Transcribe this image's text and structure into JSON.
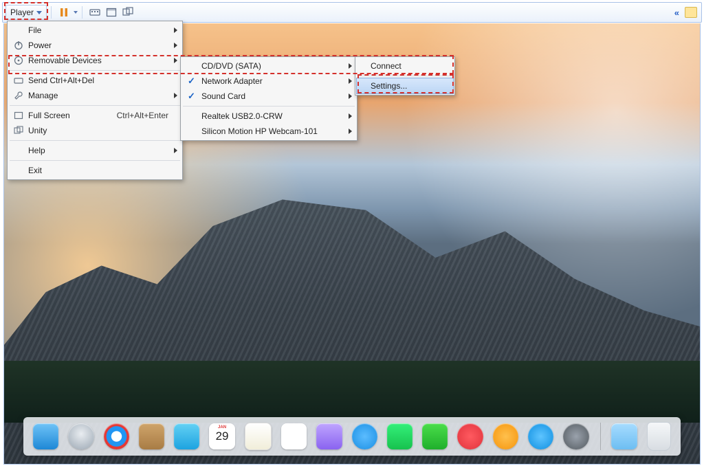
{
  "toolbar": {
    "player_label": "Player"
  },
  "menu_main": {
    "file": "File",
    "power": "Power",
    "removable": "Removable Devices",
    "send_cad": "Send Ctrl+Alt+Del",
    "manage": "Manage",
    "fullscreen": "Full Screen",
    "fullscreen_shortcut": "Ctrl+Alt+Enter",
    "unity": "Unity",
    "help": "Help",
    "exit": "Exit"
  },
  "menu_devices": {
    "cddvd": "CD/DVD (SATA)",
    "netadapter": "Network Adapter",
    "soundcard": "Sound Card",
    "realtek": "Realtek USB2.0-CRW",
    "webcam": "Silicon Motion HP Webcam-101"
  },
  "menu_cddvd": {
    "connect": "Connect",
    "settings": "Settings..."
  },
  "dock": {
    "calendar_day": "29",
    "calendar_month": "JAN"
  }
}
